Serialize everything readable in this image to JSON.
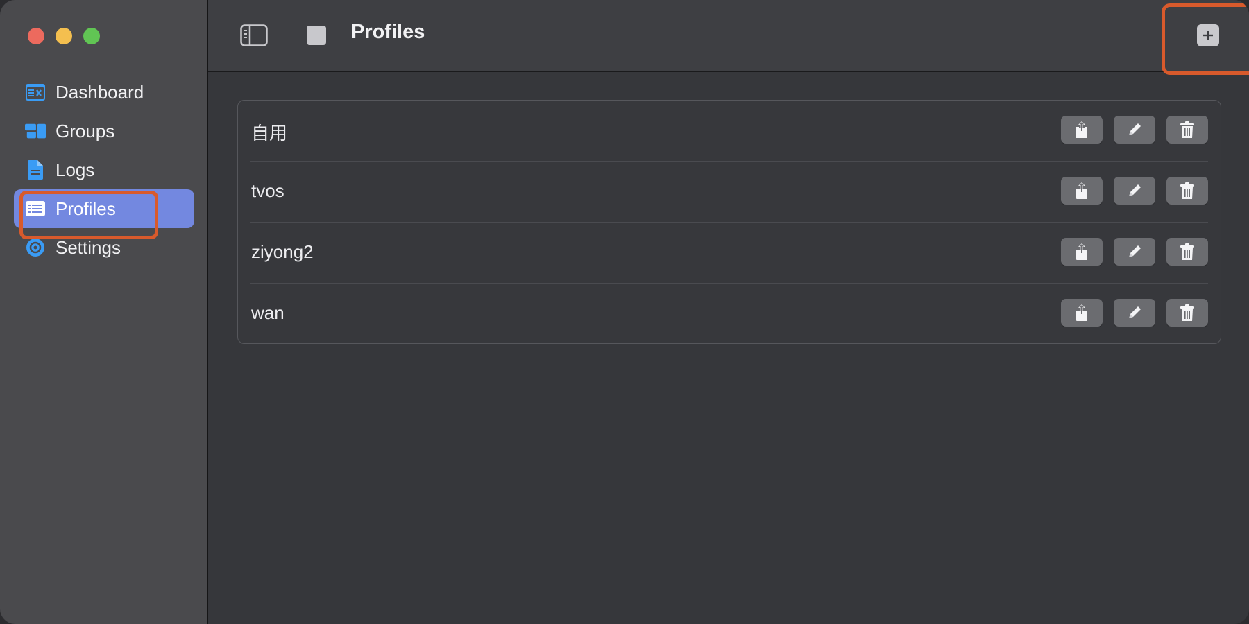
{
  "window": {
    "title": "Profiles"
  },
  "sidebar": {
    "items": [
      {
        "label": "Dashboard",
        "icon": "dashboard-icon"
      },
      {
        "label": "Groups",
        "icon": "groups-icon"
      },
      {
        "label": "Logs",
        "icon": "document-icon"
      },
      {
        "label": "Profiles",
        "icon": "list-icon",
        "active": true
      },
      {
        "label": "Settings",
        "icon": "gear-icon"
      }
    ]
  },
  "toolbar": {
    "title": "Profiles",
    "icons": [
      "sidebar-toggle-icon",
      "stop-square-icon",
      "plus-icon"
    ]
  },
  "profiles": [
    {
      "name": "自用"
    },
    {
      "name": "tvos"
    },
    {
      "name": "ziyong2"
    },
    {
      "name": "wan"
    }
  ],
  "row_actions": [
    "share-icon",
    "edit-pencil-icon",
    "trash-icon"
  ],
  "colors": {
    "accent": "#7388e0",
    "sidebar_icon": "#3a9cf5",
    "annotation": "#d85a2c",
    "close": "#ec6a5e",
    "minimize": "#f4bf4f",
    "zoom": "#61c554"
  }
}
